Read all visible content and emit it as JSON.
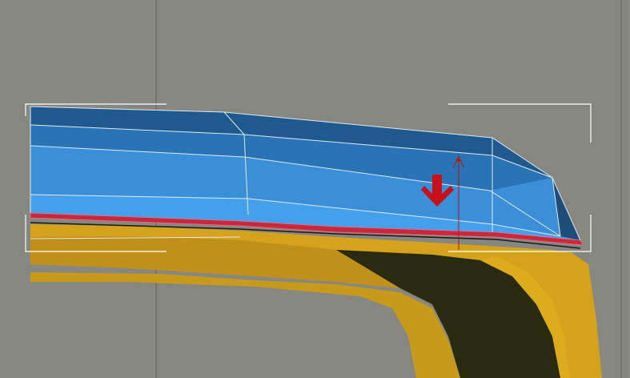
{
  "viewport": {
    "view": "perspective",
    "background_color": "#868780",
    "grid_line_color": "#5e5f5a"
  },
  "selected_object": {
    "mesh_colors": [
      "#1f5a8e",
      "#2a73b5",
      "#3b8fd9",
      "#44a0ea"
    ],
    "wireframe_color": "#dfe9ef",
    "selected_edge_color": "#c8283c",
    "base_color": "#d4a21b",
    "base_shadow_color": "#2a2a10",
    "bounding_box_color": "#ffffff"
  },
  "gizmo": {
    "move_arrow_icon": "red-down-arrow-icon",
    "arrow_color": "#c8101a",
    "pivot_axis_color": "#b01818"
  }
}
